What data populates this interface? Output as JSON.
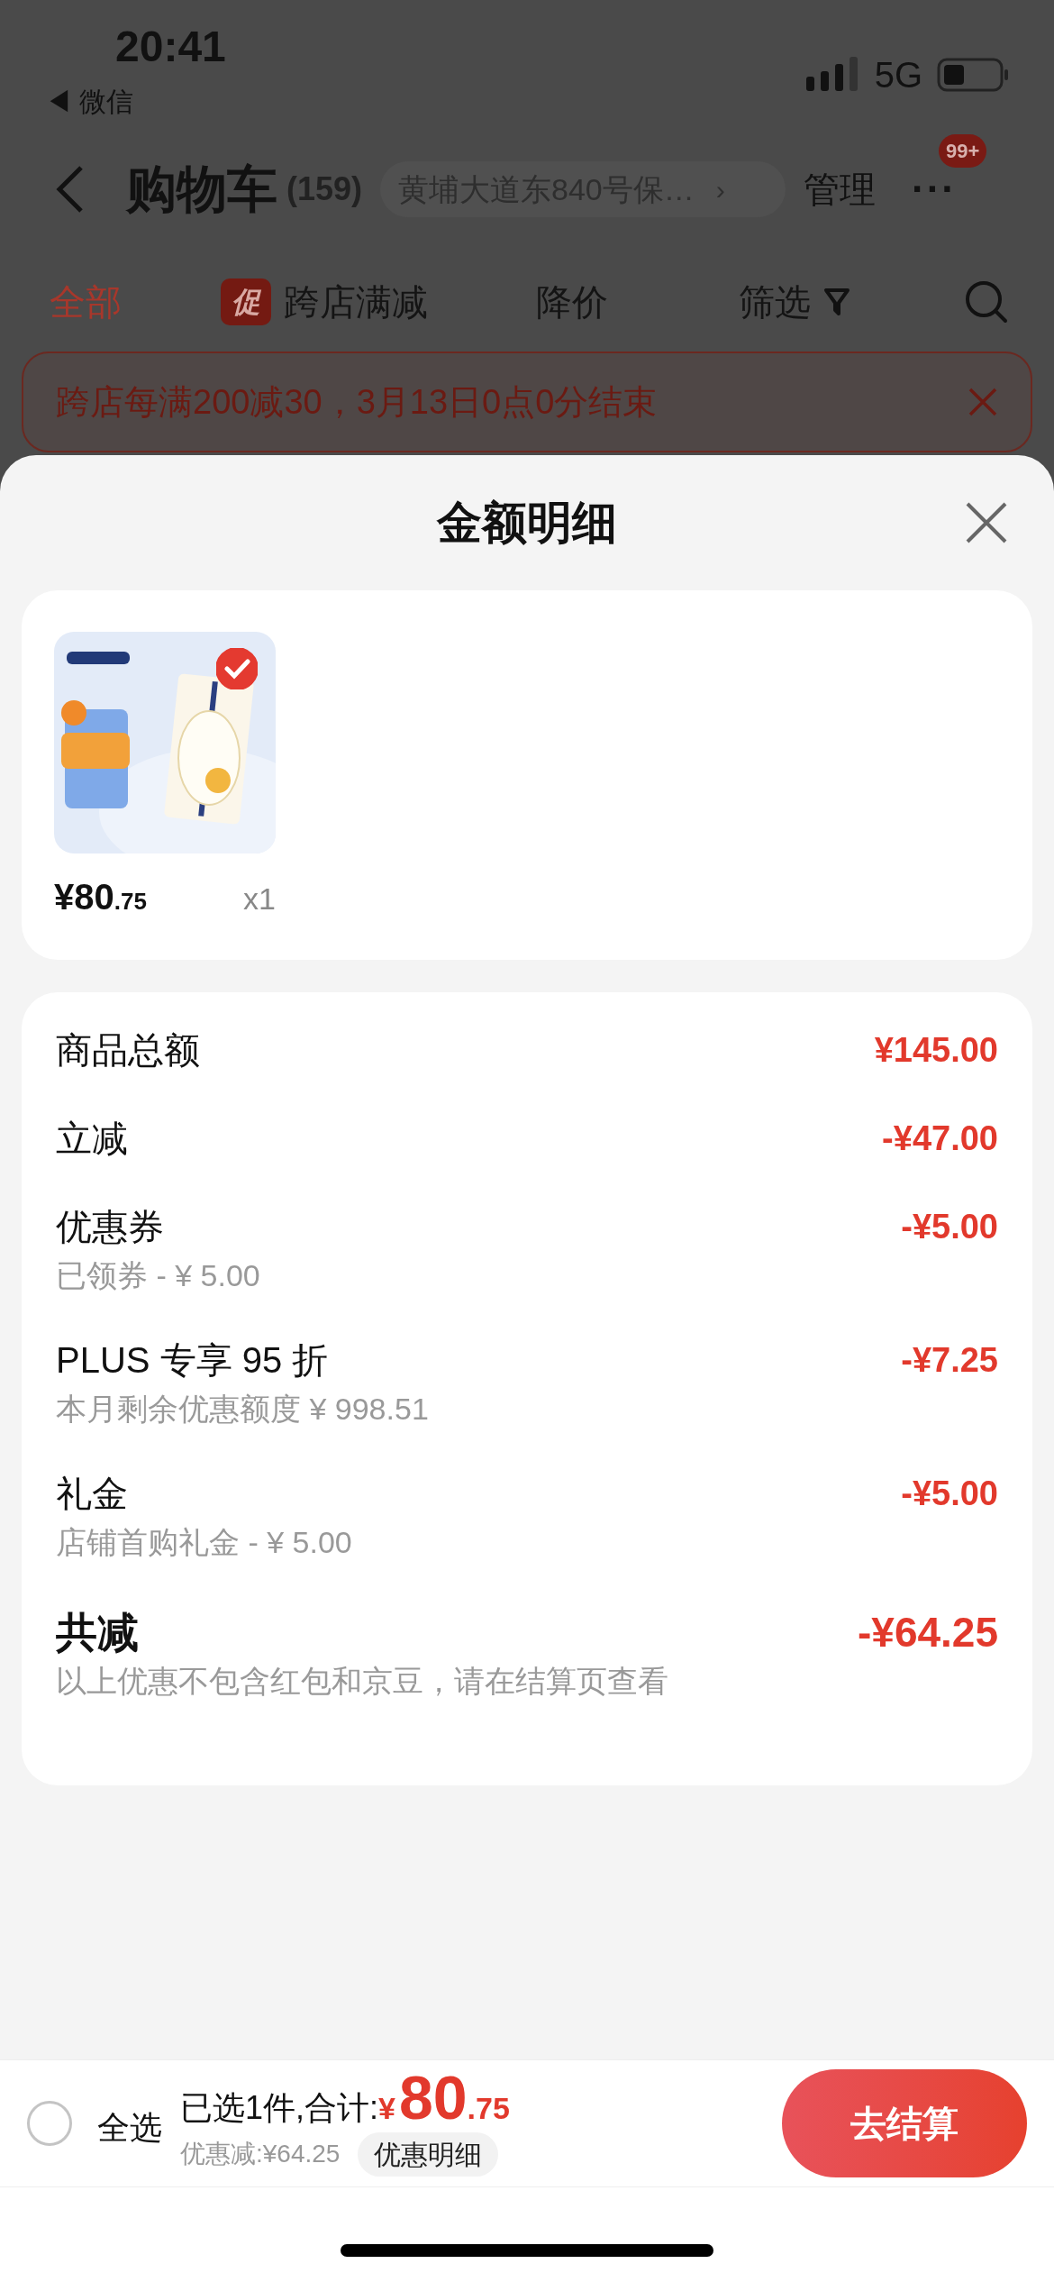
{
  "status_bar": {
    "time": "20:41",
    "back_app": "◀ 微信",
    "network": "5G"
  },
  "nav": {
    "title": "购物车",
    "count": "(159)",
    "address": "黄埔大道东840号保…",
    "address_arrow": "›",
    "manage": "管理",
    "more": "···",
    "badge": "99+"
  },
  "tabs": [
    {
      "label": "全部",
      "selected": true,
      "kind": "text"
    },
    {
      "label": "跨店满减",
      "tag": "促",
      "selected": false,
      "kind": "tag"
    },
    {
      "label": "降价",
      "selected": false,
      "kind": "text"
    },
    {
      "label": "筛选",
      "selected": false,
      "kind": "filter"
    }
  ],
  "promo_banner": {
    "text": "跨店每满200减30，3月13日0点0分结束"
  },
  "sheet": {
    "title": "金额明细",
    "product": {
      "selected": true,
      "price_main": "¥80",
      "price_decimal": ".75",
      "quantity": "x1"
    },
    "rows": [
      {
        "label": "商品总额",
        "amount": "¥145.00",
        "kind": "normal"
      },
      {
        "label": "立减",
        "amount": "-¥47.00",
        "kind": "normal"
      },
      {
        "label": "优惠券",
        "sub": "已领券 - ¥ 5.00",
        "amount": "-¥5.00",
        "kind": "normal"
      },
      {
        "label": "PLUS 专享 95 折",
        "sub": "本月剩余优惠额度 ¥ 998.51",
        "amount": "-¥7.25",
        "kind": "normal"
      },
      {
        "label": "礼金",
        "sub": "店铺首购礼金 - ¥ 5.00",
        "amount": "-¥5.00",
        "kind": "normal"
      },
      {
        "label": "共减",
        "sub": "以上优惠不包含红包和京豆，请在结算页查看",
        "amount": "-¥64.25",
        "kind": "total"
      }
    ]
  },
  "bottom_bar": {
    "select_all": {
      "label": "全选",
      "checked": false
    },
    "selected_text": "已选1件,合计:",
    "currency": "¥",
    "total_integer": "80",
    "total_decimal": ".75",
    "discount": "优惠减:¥64.25",
    "details_button": "优惠明细",
    "checkout_button": "去结算"
  }
}
